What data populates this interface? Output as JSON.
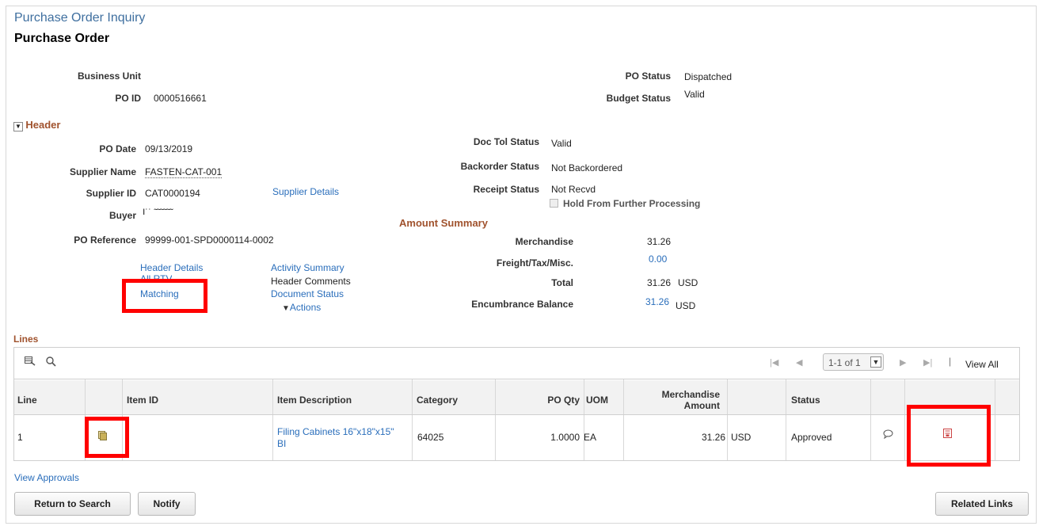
{
  "page": {
    "title": "Purchase Order Inquiry",
    "subtitle": "Purchase Order"
  },
  "top": {
    "business_unit_label": "Business Unit",
    "business_unit_value": "",
    "po_id_label": "PO ID",
    "po_id_value": "0000516661",
    "po_status_label": "PO Status",
    "po_status_value": "Dispatched",
    "budget_status_label": "Budget Status",
    "budget_status_value": "Valid"
  },
  "header": {
    "section_label": "Header",
    "po_date_label": "PO Date",
    "po_date_value": "09/13/2019",
    "supplier_name_label": "Supplier Name",
    "supplier_name_value": "FASTEN-CAT-001",
    "supplier_id_label": "Supplier ID",
    "supplier_id_value": "CAT0000194",
    "supplier_details_link": "Supplier Details",
    "buyer_label": "Buyer",
    "buyer_value": "I˙˙ ˜˜˜˜˜˜",
    "po_reference_label": "PO Reference",
    "po_reference_value": "99999-001-SPD0000114-0002",
    "doc_tol_status_label": "Doc Tol Status",
    "doc_tol_status_value": "Valid",
    "backorder_status_label": "Backorder Status",
    "backorder_status_value": "Not Backordered",
    "receipt_status_label": "Receipt Status",
    "receipt_status_value": "Not Recvd",
    "hold_label": "Hold From Further Processing",
    "links": {
      "header_details": "Header Details",
      "all_rtv": "All RTV",
      "matching": "Matching",
      "activity_summary": "Activity Summary",
      "header_comments": "Header Comments",
      "document_status": "Document Status",
      "actions": "Actions"
    }
  },
  "amount_summary": {
    "section_label": "Amount Summary",
    "merchandise_label": "Merchandise",
    "merchandise_value": "31.26",
    "freight_label": "Freight/Tax/Misc.",
    "freight_value": "0.00",
    "total_label": "Total",
    "total_value": "31.26",
    "total_currency": "USD",
    "encumbrance_label": "Encumbrance Balance",
    "encumbrance_value": "31.26",
    "encumbrance_currency": "USD"
  },
  "lines": {
    "section_label": "Lines",
    "pager_text": "1-1 of 1",
    "view_all": "View All",
    "columns": {
      "line": "Line",
      "item_id": "Item ID",
      "item_description": "Item Description",
      "category": "Category",
      "po_qty": "PO Qty",
      "uom": "UOM",
      "merch_amount_1": "Merchandise",
      "merch_amount_2": "Amount",
      "status": "Status"
    },
    "rows": [
      {
        "line": "1",
        "item_id": "",
        "item_description_1": "Filing Cabinets 16\"x18\"x15\"",
        "item_description_2": "BI",
        "category": "64025",
        "po_qty": "1.0000",
        "uom": "EA",
        "amount": "31.26",
        "currency": "USD",
        "status": "Approved"
      }
    ]
  },
  "footer": {
    "view_approvals": "View Approvals",
    "return_to_search": "Return to Search",
    "notify": "Notify",
    "related_links": "Related Links"
  },
  "colors": {
    "link": "#2a6ebb",
    "section": "#a0522d",
    "highlight": "#ff0000"
  },
  "icons": [
    "collapse-icon",
    "personalize-grid-icon",
    "search-icon",
    "first-page-icon",
    "prev-page-icon",
    "next-page-icon",
    "last-page-icon",
    "line-details-icon",
    "comment-icon",
    "document-icon"
  ]
}
